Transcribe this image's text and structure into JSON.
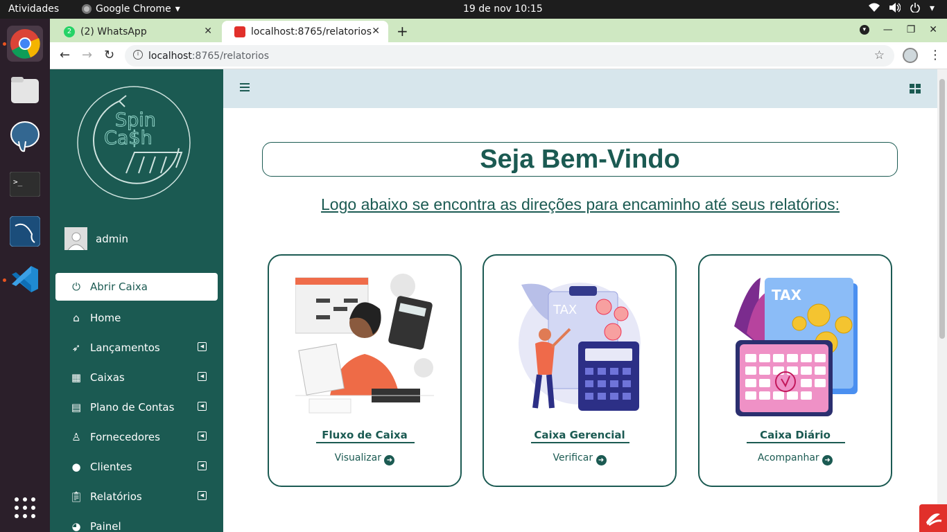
{
  "os": {
    "activities": "Atividades",
    "app_name": "Google Chrome",
    "clock": "19 de nov  10:15",
    "tray_icons": [
      "wifi-icon",
      "volume-icon",
      "power-icon"
    ]
  },
  "dock": [
    "chrome-icon",
    "files-icon",
    "postgres-icon",
    "terminal-icon",
    "mysql-workbench-icon",
    "vscode-icon",
    "app-grid-icon"
  ],
  "browser": {
    "tabs": [
      {
        "title": "(2) WhatsApp",
        "badge": "2"
      },
      {
        "title": "localhost:8765/relatorios"
      }
    ],
    "url_host": "localhost",
    "url_path": ":8765/relatorios"
  },
  "sidebar": {
    "user": "admin",
    "items": [
      {
        "label": "Abrir Caixa",
        "icon": "power-icon"
      },
      {
        "label": "Home",
        "icon": "home-icon"
      },
      {
        "label": "Lançamentos",
        "icon": "rocket-icon"
      },
      {
        "label": "Caixas",
        "icon": "boxes-icon"
      },
      {
        "label": "Plano de Contas",
        "icon": "file-invoice-icon"
      },
      {
        "label": "Fornecedores",
        "icon": "user-tie-icon"
      },
      {
        "label": "Clientes",
        "icon": "user-icon"
      },
      {
        "label": "Relatórios",
        "icon": "clipboard-icon"
      },
      {
        "label": "Painel",
        "icon": "chart-pie-icon"
      }
    ]
  },
  "main": {
    "title": "Seja Bem-Vindo",
    "subtitle": "Logo abaixo se encontra as direções para encaminho até seus relatórios:",
    "cards": [
      {
        "title": "Fluxo de Caixa",
        "link": "Visualizar"
      },
      {
        "title": "Caixa Gerencial",
        "link": "Verificar"
      },
      {
        "title": "Caixa Diário",
        "link": "Acompanhar"
      }
    ]
  },
  "colors": {
    "primary": "#1b5a52",
    "topbar": "#d7e6ec",
    "tabstrip": "#cfe8c2"
  }
}
